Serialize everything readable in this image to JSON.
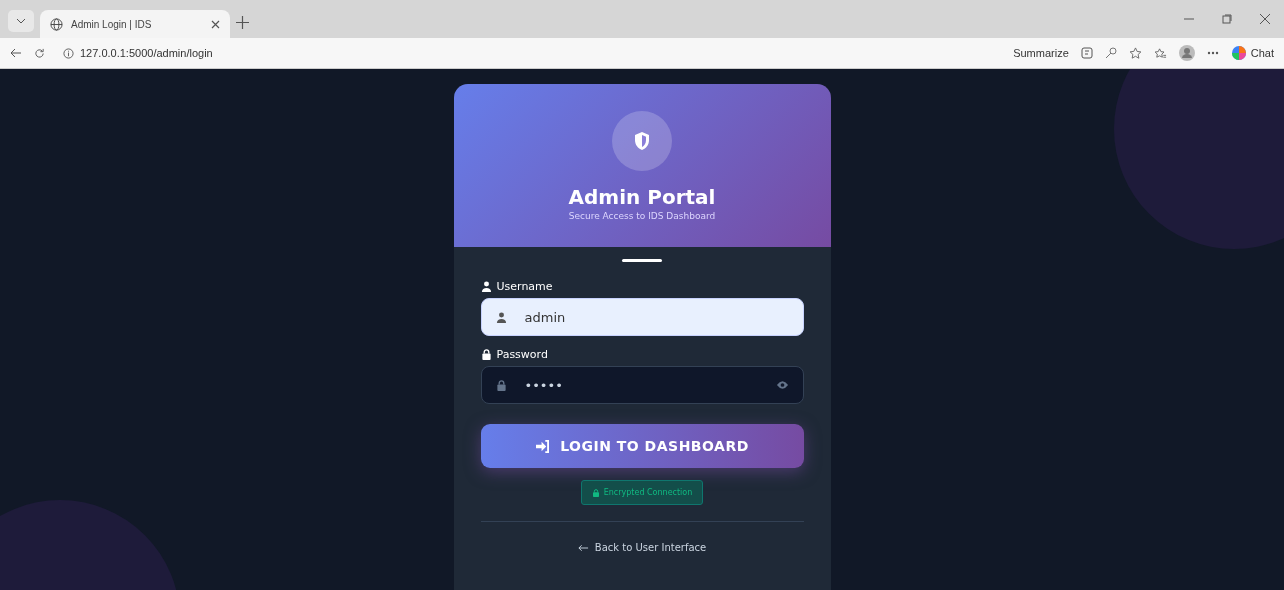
{
  "browser": {
    "tab_title": "Admin Login | IDS",
    "url": "127.0.0.1:5000/admin/login",
    "summarize": "Summarize",
    "chat": "Chat"
  },
  "card": {
    "title": "Admin Portal",
    "subtitle": "Secure Access to IDS Dashboard",
    "fields": [
      {
        "kind": "text",
        "label": "Username",
        "value": "admin",
        "focused": true
      },
      {
        "kind": "password",
        "label": "Password",
        "value": "•••••",
        "focused": false
      }
    ],
    "login_button": "LOGIN TO DASHBOARD",
    "badge": "Encrypted Connection",
    "back_link": "Back to User Interface"
  }
}
